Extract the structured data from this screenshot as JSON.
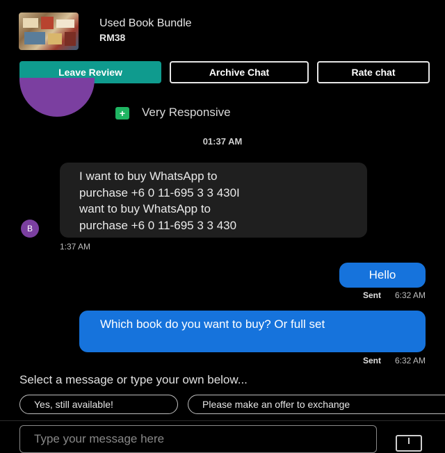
{
  "listing": {
    "title": "Used Book Bundle",
    "price": "RM38"
  },
  "actions": {
    "leave_review": "Leave Review",
    "archive_chat": "Archive Chat",
    "rate_chat": "Rate chat"
  },
  "seller": {
    "badge": "Very Responsive",
    "avatar_initial": "B"
  },
  "chat": {
    "date_stamp": "01:37 AM",
    "incoming": {
      "lines": [
        "I want to buy WhatsApp to",
        "purchase  +6 0 11-695  3 3 430I",
        "want to buy WhatsApp to",
        "purchase  +6 0 11-695  3 3 430"
      ],
      "time": "1:37 AM"
    },
    "outgoing": [
      {
        "text": "Hello",
        "status": "Sent",
        "time": "6:32 AM"
      },
      {
        "text": "Which book do you want to buy? Or full set",
        "status": "Sent",
        "time": "6:32 AM"
      }
    ]
  },
  "quick_replies": {
    "prompt": "Select a message or type your own below...",
    "chips": [
      "Yes, still available!",
      "Please make an offer to exchange"
    ]
  },
  "composer": {
    "placeholder": "Type your message here"
  },
  "colors": {
    "primary": "#0f9b8e",
    "outgoing_bubble": "#1673dc",
    "incoming_bubble": "#1f1f1f",
    "avatar": "#7b3fa0",
    "responsive_badge": "#1fb562"
  }
}
